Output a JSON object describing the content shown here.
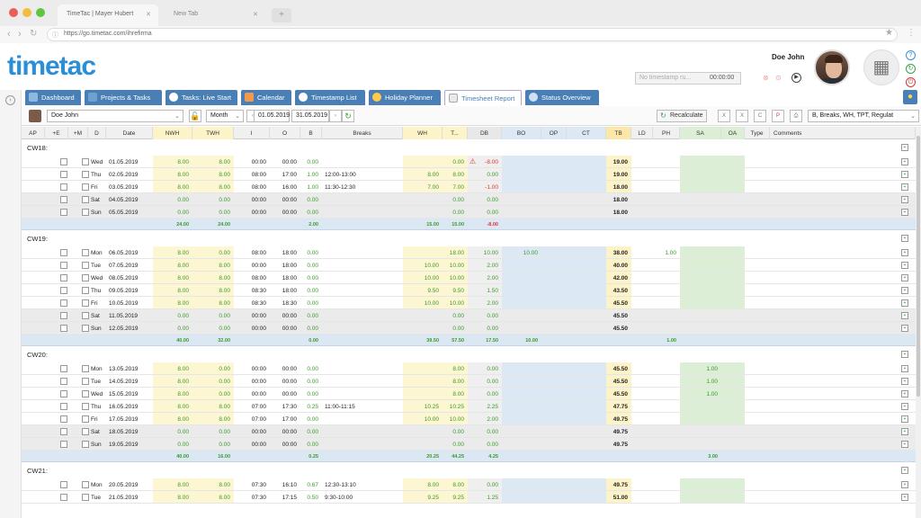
{
  "browser": {
    "tabs": [
      {
        "title": "TimeTac | Mayer Hubert"
      },
      {
        "title": "New Tab"
      }
    ],
    "url": "https://go.timetac.com/ihrefirma"
  },
  "header": {
    "logo": "timetac",
    "user_name": "Doe John",
    "timestamp_placeholder": "No timestamp ru...",
    "timestamp_time": "00:00:00"
  },
  "nav_tabs": [
    {
      "label": "Dashboard",
      "icon": "dashboard-icon"
    },
    {
      "label": "Projects & Tasks",
      "icon": "folder-icon"
    },
    {
      "label": "Tasks: Live Start",
      "icon": "play-icon"
    },
    {
      "label": "Calendar",
      "icon": "calendar-icon"
    },
    {
      "label": "Timestamp List",
      "icon": "clock-icon"
    },
    {
      "label": "Holiday Planner",
      "icon": "sun-icon"
    },
    {
      "label": "Timesheet Report",
      "icon": "report-icon"
    },
    {
      "label": "Status Overview",
      "icon": "person-icon"
    }
  ],
  "toolbar": {
    "user": "Doe John",
    "period": "Month",
    "date_from": "01.05.2019",
    "date_to": "31.05.2019",
    "recalculate": "Recalculate",
    "columns": "B, Breaks, WH, TPT, Regulat"
  },
  "columns": [
    "AP",
    "+E",
    "+M",
    "D",
    "Date",
    "NWH",
    "TWH",
    "I",
    "O",
    "B",
    "Breaks",
    "WH",
    "T...",
    "DB",
    "BO",
    "OP",
    "CT",
    "TB",
    "LD",
    "PH",
    "SA",
    "OA",
    "Type",
    "Comments"
  ],
  "weeks": [
    {
      "label": "CW18:",
      "rows": [
        {
          "d": "Wed",
          "date": "01.05.2019",
          "nwh": "8.00",
          "twh": "8.00",
          "i": "00:00",
          "o": "00:00",
          "b": "0.00",
          "breaks": "",
          "wh": "",
          "t": "0.00",
          "db": "-8.00",
          "bo": "",
          "op": "",
          "tb": "19.00",
          "ph": "",
          "sa": "",
          "warn": true,
          "we": false
        },
        {
          "d": "Thu",
          "date": "02.05.2019",
          "nwh": "8.00",
          "twh": "8.00",
          "i": "08:00",
          "o": "17:00",
          "b": "1.00",
          "breaks": "12:00-13:00",
          "wh": "8.00",
          "t": "8.00",
          "db": "0.00",
          "bo": "",
          "op": "",
          "tb": "19.00",
          "ph": "",
          "sa": "",
          "we": false
        },
        {
          "d": "Fri",
          "date": "03.05.2019",
          "nwh": "8.00",
          "twh": "8.00",
          "i": "08:00",
          "o": "16:00",
          "b": "1.00",
          "breaks": "11:30-12:30",
          "wh": "7.00",
          "t": "7.00",
          "db": "-1.00",
          "bo": "",
          "op": "",
          "tb": "18.00",
          "ph": "",
          "sa": "",
          "we": false
        },
        {
          "d": "Sat",
          "date": "04.05.2019",
          "nwh": "0.00",
          "twh": "0.00",
          "i": "00:00",
          "o": "00:00",
          "b": "0.00",
          "breaks": "",
          "wh": "",
          "t": "0.00",
          "db": "0.00",
          "bo": "",
          "op": "",
          "tb": "18.00",
          "ph": "",
          "sa": "",
          "we": true
        },
        {
          "d": "Sun",
          "date": "05.05.2019",
          "nwh": "0.00",
          "twh": "0.00",
          "i": "00:00",
          "o": "00:00",
          "b": "0.00",
          "breaks": "",
          "wh": "",
          "t": "0.00",
          "db": "0.00",
          "bo": "",
          "op": "",
          "tb": "18.00",
          "ph": "",
          "sa": "",
          "we": true
        }
      ],
      "sum": {
        "nwh": "24.00",
        "twh": "24.00",
        "b": "2.00",
        "wh": "15.00",
        "t": "15.00",
        "db": "-8.00",
        "bo": "",
        "ph": "",
        "sa": ""
      }
    },
    {
      "label": "CW19:",
      "rows": [
        {
          "d": "Mon",
          "date": "06.05.2019",
          "nwh": "8.00",
          "twh": "0.00",
          "i": "08:00",
          "o": "18:00",
          "b": "0.00",
          "breaks": "",
          "wh": "",
          "t": "18.00",
          "db": "10.00",
          "bo": "10.00",
          "op": "",
          "tb": "38.00",
          "ph": "1.00",
          "sa": "",
          "we": false
        },
        {
          "d": "Tue",
          "date": "07.05.2019",
          "nwh": "8.00",
          "twh": "8.00",
          "i": "00:00",
          "o": "18:00",
          "b": "0.00",
          "breaks": "",
          "wh": "10.00",
          "t": "10.00",
          "db": "2.00",
          "bo": "",
          "op": "",
          "tb": "40.00",
          "ph": "",
          "sa": "",
          "we": false
        },
        {
          "d": "Wed",
          "date": "08.05.2019",
          "nwh": "8.00",
          "twh": "8.00",
          "i": "08:00",
          "o": "18:00",
          "b": "0.00",
          "breaks": "",
          "wh": "10.00",
          "t": "10.00",
          "db": "2.00",
          "bo": "",
          "op": "",
          "tb": "42.00",
          "ph": "",
          "sa": "",
          "we": false
        },
        {
          "d": "Thu",
          "date": "09.05.2019",
          "nwh": "8.00",
          "twh": "8.00",
          "i": "08:30",
          "o": "18:00",
          "b": "0.00",
          "breaks": "",
          "wh": "9.50",
          "t": "9.50",
          "db": "1.50",
          "bo": "",
          "op": "",
          "tb": "43.50",
          "ph": "",
          "sa": "",
          "we": false
        },
        {
          "d": "Fri",
          "date": "10.05.2019",
          "nwh": "8.00",
          "twh": "8.00",
          "i": "08:30",
          "o": "18:30",
          "b": "0.00",
          "breaks": "",
          "wh": "10.00",
          "t": "10.00",
          "db": "2.00",
          "bo": "",
          "op": "",
          "tb": "45.50",
          "ph": "",
          "sa": "",
          "we": false
        },
        {
          "d": "Sat",
          "date": "11.05.2019",
          "nwh": "0.00",
          "twh": "0.00",
          "i": "00:00",
          "o": "00:00",
          "b": "0.00",
          "breaks": "",
          "wh": "",
          "t": "0.00",
          "db": "0.00",
          "bo": "",
          "op": "",
          "tb": "45.50",
          "ph": "",
          "sa": "",
          "we": true
        },
        {
          "d": "Sun",
          "date": "12.05.2019",
          "nwh": "0.00",
          "twh": "0.00",
          "i": "00:00",
          "o": "00:00",
          "b": "0.00",
          "breaks": "",
          "wh": "",
          "t": "0.00",
          "db": "0.00",
          "bo": "",
          "op": "",
          "tb": "45.50",
          "ph": "",
          "sa": "",
          "we": true
        }
      ],
      "sum": {
        "nwh": "40.00",
        "twh": "32.00",
        "b": "0.00",
        "wh": "39.50",
        "t": "57.50",
        "db": "17.50",
        "bo": "10.00",
        "ph": "1.00",
        "sa": ""
      }
    },
    {
      "label": "CW20:",
      "rows": [
        {
          "d": "Mon",
          "date": "13.05.2019",
          "nwh": "8.00",
          "twh": "0.00",
          "i": "00:00",
          "o": "00:00",
          "b": "0.00",
          "breaks": "",
          "wh": "",
          "t": "8.00",
          "db": "0.00",
          "bo": "",
          "op": "",
          "tb": "45.50",
          "ph": "",
          "sa": "1.00",
          "we": false
        },
        {
          "d": "Tue",
          "date": "14.05.2019",
          "nwh": "8.00",
          "twh": "0.00",
          "i": "00:00",
          "o": "00:00",
          "b": "0.00",
          "breaks": "",
          "wh": "",
          "t": "8.00",
          "db": "0.00",
          "bo": "",
          "op": "",
          "tb": "45.50",
          "ph": "",
          "sa": "1.00",
          "we": false
        },
        {
          "d": "Wed",
          "date": "15.05.2019",
          "nwh": "8.00",
          "twh": "0.00",
          "i": "00:00",
          "o": "00:00",
          "b": "0.00",
          "breaks": "",
          "wh": "",
          "t": "8.00",
          "db": "0.00",
          "bo": "",
          "op": "",
          "tb": "45.50",
          "ph": "",
          "sa": "1.00",
          "we": false
        },
        {
          "d": "Thu",
          "date": "16.05.2019",
          "nwh": "8.00",
          "twh": "8.00",
          "i": "07:00",
          "o": "17:30",
          "b": "0.25",
          "breaks": "11:00-11:15",
          "wh": "10.25",
          "t": "10.25",
          "db": "2.25",
          "bo": "",
          "op": "",
          "tb": "47.75",
          "ph": "",
          "sa": "",
          "we": false
        },
        {
          "d": "Fri",
          "date": "17.05.2019",
          "nwh": "8.00",
          "twh": "8.00",
          "i": "07:00",
          "o": "17:00",
          "b": "0.00",
          "breaks": "",
          "wh": "10.00",
          "t": "10.00",
          "db": "2.00",
          "bo": "",
          "op": "",
          "tb": "49.75",
          "ph": "",
          "sa": "",
          "we": false
        },
        {
          "d": "Sat",
          "date": "18.05.2019",
          "nwh": "0.00",
          "twh": "0.00",
          "i": "00:00",
          "o": "00:00",
          "b": "0.00",
          "breaks": "",
          "wh": "",
          "t": "0.00",
          "db": "0.00",
          "bo": "",
          "op": "",
          "tb": "49.75",
          "ph": "",
          "sa": "",
          "we": true
        },
        {
          "d": "Sun",
          "date": "19.05.2019",
          "nwh": "0.00",
          "twh": "0.00",
          "i": "00:00",
          "o": "00:00",
          "b": "0.00",
          "breaks": "",
          "wh": "",
          "t": "0.00",
          "db": "0.00",
          "bo": "",
          "op": "",
          "tb": "49.75",
          "ph": "",
          "sa": "",
          "we": true
        }
      ],
      "sum": {
        "nwh": "40.00",
        "twh": "16.00",
        "b": "0.25",
        "wh": "20.25",
        "t": "44.25",
        "db": "4.25",
        "bo": "",
        "ph": "",
        "sa": "3.00"
      }
    },
    {
      "label": "CW21:",
      "rows": [
        {
          "d": "Mon",
          "date": "20.05.2019",
          "nwh": "8.00",
          "twh": "8.00",
          "i": "07:30",
          "o": "16:10",
          "b": "0.67",
          "breaks": "12:30-13:10",
          "wh": "8.00",
          "t": "8.00",
          "db": "0.00",
          "bo": "",
          "op": "",
          "tb": "49.75",
          "ph": "",
          "sa": "",
          "we": false
        },
        {
          "d": "Tue",
          "date": "21.05.2019",
          "nwh": "8.00",
          "twh": "8.00",
          "i": "07:30",
          "o": "17:15",
          "b": "0.50",
          "breaks": "9:30-10:00",
          "wh": "9.25",
          "t": "9.25",
          "db": "1.25",
          "bo": "",
          "op": "",
          "tb": "51.00",
          "ph": "",
          "sa": "",
          "we": false
        }
      ]
    }
  ]
}
